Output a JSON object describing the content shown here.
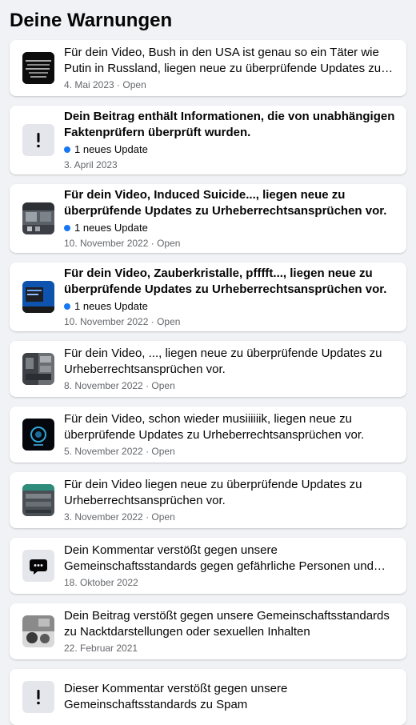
{
  "header": {
    "title": "Deine Warnungen"
  },
  "items": [
    {
      "title": "Für dein Video, Bush in den USA ist genau so ein Täter wie Putin in Russland, liegen neue zu überprüfende Updates zu Urheberrechtsansprüchen vor.",
      "date": "4. Mai 2023",
      "status": "Open",
      "update": ""
    },
    {
      "title": "Dein Beitrag enthält Informationen, die von unabhängigen Faktenprüfern überprüft wurden.",
      "date": "3. April 2023",
      "status": "",
      "update": "1 neues Update"
    },
    {
      "title": "Für dein Video, Induced Suicide..., liegen neue zu überprüfende Updates zu Urheberrechtsansprüchen vor.",
      "date": "10. November 2022",
      "status": "Open",
      "update": "1 neues Update"
    },
    {
      "title": "Für dein Video, Zauberkristalle, pfffft..., liegen neue zu überprüfende Updates zu Urheberrechtsansprüchen vor.",
      "date": "10. November 2022",
      "status": "Open",
      "update": "1 neues Update"
    },
    {
      "title": "Für dein Video, ..., liegen neue zu überprüfende Updates zu Urheberrechtsansprüchen vor.",
      "date": "8. November 2022",
      "status": "Open",
      "update": ""
    },
    {
      "title": "Für dein Video, schon wieder musiiiiiik, liegen neue zu überprüfende Updates zu Urheberrechtsansprüchen vor.",
      "date": "5. November 2022",
      "status": "Open",
      "update": ""
    },
    {
      "title": "Für dein Video liegen neue zu überprüfende Updates zu Urheberrechtsansprüchen vor.",
      "date": "3. November 2022",
      "status": "Open",
      "update": ""
    },
    {
      "title": "Dein Kommentar verstößt gegen unsere Gemeinschaftsstandards gegen gefährliche Personen und Organisationen",
      "date": "18. Oktober 2022",
      "status": "",
      "update": ""
    },
    {
      "title": "Dein Beitrag verstößt gegen unsere Gemeinschaftsstandards zu Nacktdarstellungen oder sexuellen Inhalten",
      "date": "22. Februar 2021",
      "status": "",
      "update": ""
    },
    {
      "title": "Dieser Kommentar verstößt gegen unsere Gemeinschaftsstandards zu Spam",
      "date": "",
      "status": "",
      "update": ""
    }
  ],
  "colors": {
    "accent": "#1877f2",
    "secondary_text": "#65676b",
    "background": "#f0f2f5"
  }
}
